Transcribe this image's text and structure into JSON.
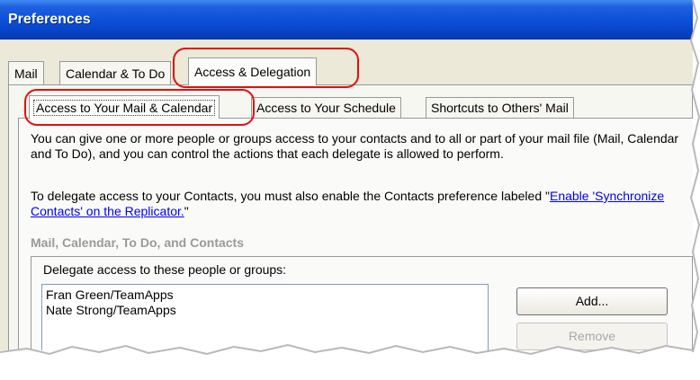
{
  "window": {
    "title": "Preferences"
  },
  "tabs": [
    {
      "label": "Mail",
      "active": false
    },
    {
      "label": "Calendar & To Do",
      "active": false
    },
    {
      "label": "Access & Delegation",
      "active": true
    }
  ],
  "subtabs": [
    {
      "label": "Access to Your Mail & Calendar",
      "active": true
    },
    {
      "label": "Access to Your Schedule",
      "active": false
    },
    {
      "label": "Shortcuts to Others' Mail",
      "active": false
    }
  ],
  "intro_text": "You can give one or more people or groups access to your contacts and to all or part of your mail file (Mail, Calendar and To Do), and you can control the actions that each delegate is allowed to perform.",
  "contacts_note": {
    "text": "To delegate access to your Contacts, you must also enable the Contacts preference labeled \"",
    "link": "Enable 'Synchronize Contacts' on the Replicator.",
    "suffix": "\""
  },
  "section": {
    "title": "Mail, Calendar, To Do, and Contacts",
    "caption": "Delegate access to these people or groups:",
    "delegates": [
      "Fran Green/TeamApps",
      "Nate Strong/TeamApps"
    ],
    "add_label": "Add...",
    "remove_label": "Remove"
  },
  "colors": {
    "titlebar": "#0a4fd8",
    "annotation": "#e01010",
    "link": "#0000ee"
  }
}
